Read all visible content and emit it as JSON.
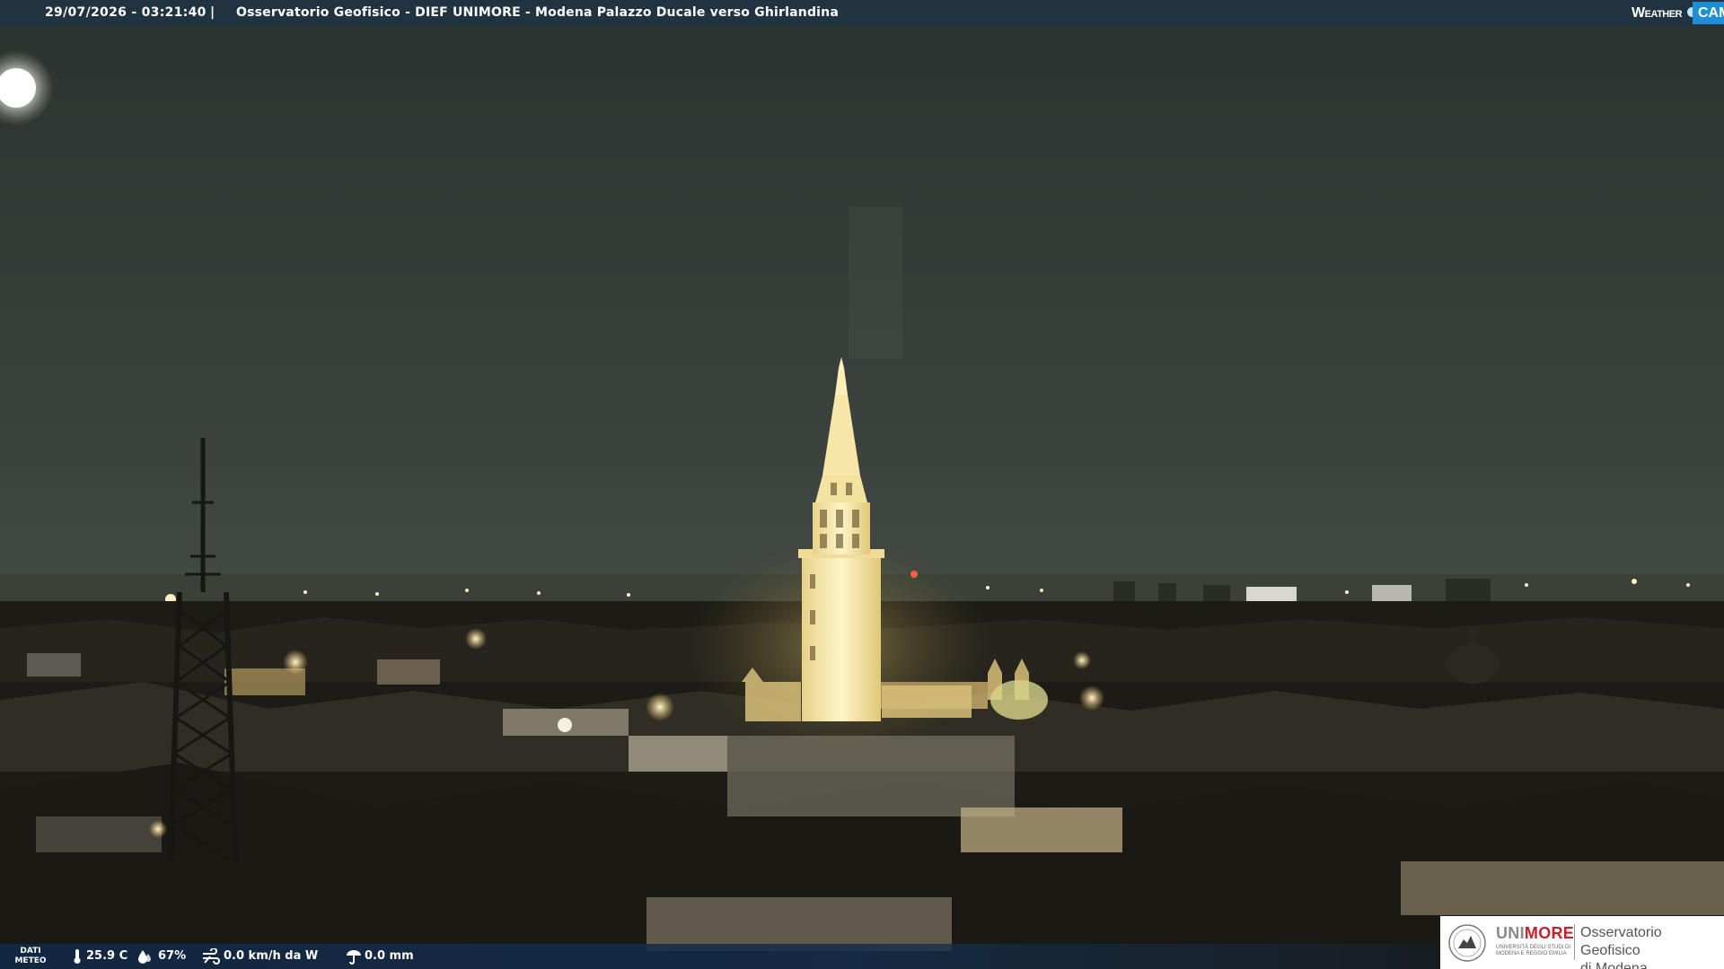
{
  "header": {
    "timestamp": "29/07/2026 - 03:21:40",
    "separator": "|",
    "title": "Osservatorio Geofisico - DIEF UNIMORE - Modena Palazzo Ducale verso Ghirlandina",
    "brand_left": "Weather",
    "brand_right": "CAM"
  },
  "weather": {
    "dati_line1": "DATI",
    "dati_line2": "METEO",
    "temperature": "25.9 C",
    "humidity": "67%",
    "wind": "0.0 km/h da W",
    "rain": "0.0 mm"
  },
  "institution": {
    "uni_a": "UNI",
    "uni_b": "MORE",
    "uni_subtitle": "UNIVERSITÀ DEGLI STUDI DI MODENA E REGGIO EMILIA",
    "observatory_line1": "Osservatorio Geofisico",
    "observatory_line2": "di Modena"
  },
  "colors": {
    "sky": "#3a403c",
    "tower_light": "#f6e6a6",
    "bar_blue": "#1e8fd6",
    "brand_red": "#c8202b"
  },
  "icons": [
    "thermometer-icon",
    "humidity-icon",
    "wind-icon",
    "rain-icon",
    "university-seal-icon",
    "moon-icon"
  ]
}
